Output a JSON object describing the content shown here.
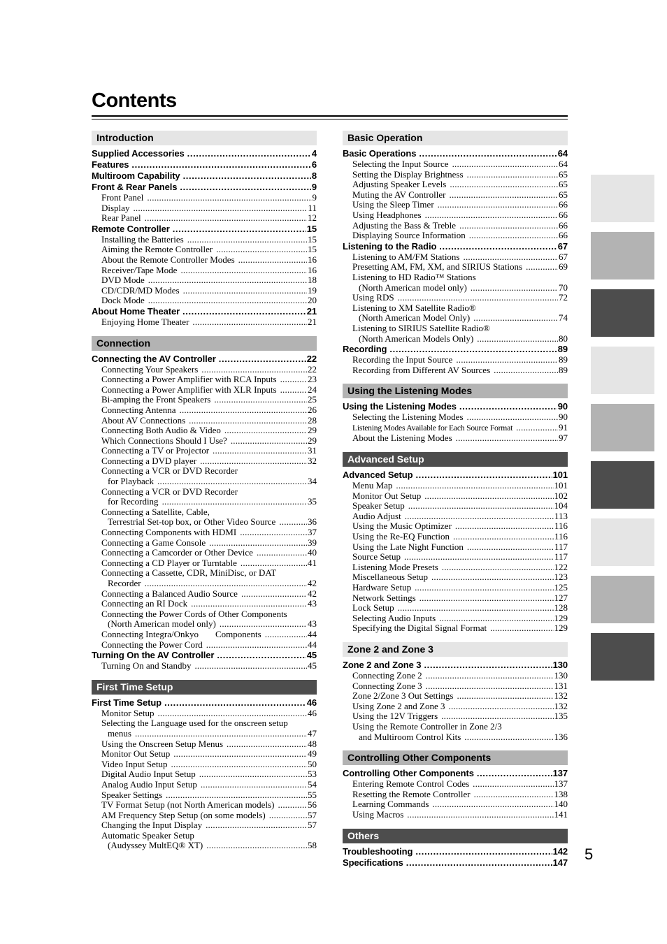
{
  "page": {
    "title": "Contents",
    "page_number": "5"
  },
  "left_column": [
    {
      "header": "Introduction",
      "style": "light",
      "entries": [
        {
          "level": 1,
          "text": "Supplied Accessories",
          "page": "4"
        },
        {
          "level": 1,
          "text": "Features",
          "page": "6"
        },
        {
          "level": 1,
          "text": "Multiroom Capability",
          "page": "8"
        },
        {
          "level": 1,
          "text": "Front & Rear Panels",
          "page": "9"
        },
        {
          "level": 2,
          "text": "Front Panel",
          "page": "9"
        },
        {
          "level": 2,
          "text": "Display",
          "page": "11"
        },
        {
          "level": 2,
          "text": "Rear Panel",
          "page": "12"
        },
        {
          "level": 1,
          "text": "Remote Controller",
          "page": "15"
        },
        {
          "level": 2,
          "text": "Installing the Batteries",
          "page": "15"
        },
        {
          "level": 2,
          "text": "Aiming the Remote Controller",
          "page": "15"
        },
        {
          "level": 2,
          "text": "About the Remote Controller Modes",
          "page": "16"
        },
        {
          "level": 2,
          "text": "Receiver/Tape Mode",
          "page": "16"
        },
        {
          "level": 2,
          "text": "DVD Mode",
          "page": "18"
        },
        {
          "level": 2,
          "text": "CD/CDR/MD Modes",
          "page": "19"
        },
        {
          "level": 2,
          "text": "Dock Mode",
          "page": "20"
        },
        {
          "level": 1,
          "text": "About Home Theater",
          "page": "21"
        },
        {
          "level": 2,
          "text": "Enjoying Home Theater",
          "page": "21"
        }
      ]
    },
    {
      "header": "Connection",
      "style": "mid",
      "entries": [
        {
          "level": 1,
          "text": "Connecting the AV Controller",
          "page": "22"
        },
        {
          "level": 2,
          "text": "Connecting Your Speakers",
          "page": "22"
        },
        {
          "level": 2,
          "text": "Connecting a Power Amplifier with RCA Inputs",
          "page": "23"
        },
        {
          "level": 2,
          "text": "Connecting a Power Amplifier with XLR Inputs",
          "page": "24"
        },
        {
          "level": 2,
          "text": "Bi-amping the Front Speakers",
          "page": "25"
        },
        {
          "level": 2,
          "text": "Connecting Antenna",
          "page": "26"
        },
        {
          "level": 2,
          "text": "About AV Connections",
          "page": "28"
        },
        {
          "level": 2,
          "text": "Connecting Both Audio & Video",
          "page": "29"
        },
        {
          "level": 2,
          "text": "Which Connections Should I Use?",
          "page": "29"
        },
        {
          "level": 2,
          "text": "Connecting a TV or Projector",
          "page": "31"
        },
        {
          "level": 2,
          "text": "Connecting a DVD player",
          "page": "32"
        },
        {
          "level": 2,
          "text": "Connecting a VCR or DVD Recorder",
          "cont": "for Playback",
          "page": "34"
        },
        {
          "level": 2,
          "text": "Connecting a VCR or DVD Recorder",
          "cont": "for Recording",
          "page": "35"
        },
        {
          "level": 2,
          "text": "Connecting a Satellite, Cable,",
          "cont": "Terrestrial Set-top box, or Other Video Source",
          "page": "36"
        },
        {
          "level": 2,
          "text": "Connecting Components with HDMI",
          "page": "37"
        },
        {
          "level": 2,
          "text": "Connecting a Game Console",
          "page": "39"
        },
        {
          "level": 2,
          "text": "Connecting a Camcorder or Other Device",
          "page": "40"
        },
        {
          "level": 2,
          "text": "Connecting a CD Player or Turntable",
          "page": "41"
        },
        {
          "level": 2,
          "text": "Connecting a Cassette, CDR, MiniDisc, or DAT",
          "cont": "Recorder",
          "page": "42"
        },
        {
          "level": 2,
          "text": "Connecting a Balanced Audio Source",
          "page": "42"
        },
        {
          "level": 2,
          "text": "Connecting an RI Dock",
          "page": "43"
        },
        {
          "level": 2,
          "text": "Connecting the Power Cords of Other Components",
          "cont": "(North American model only)",
          "page": "43"
        },
        {
          "level": 2,
          "text": "Connecting Integra/Onkyo",
          "text_after_gap": "Components",
          "page": "44"
        },
        {
          "level": 2,
          "text": "Connecting the Power Cord",
          "page": "44"
        },
        {
          "level": 1,
          "text": "Turning On the AV Controller",
          "page": "45"
        },
        {
          "level": 2,
          "text": "Turning On and Standby",
          "page": "45"
        }
      ]
    },
    {
      "header": "First Time Setup",
      "style": "dark",
      "entries": [
        {
          "level": 1,
          "text": "First Time Setup",
          "page": "46"
        },
        {
          "level": 2,
          "text": "Monitor Setup",
          "page": "46"
        },
        {
          "level": 2,
          "text": "Selecting the Language used for the onscreen setup",
          "cont": "menus",
          "page": "47"
        },
        {
          "level": 2,
          "text": "Using the Onscreen Setup Menus",
          "page": "48"
        },
        {
          "level": 2,
          "text": "Monitor Out Setup",
          "page": "49"
        },
        {
          "level": 2,
          "text": "Video Input Setup",
          "page": "50"
        },
        {
          "level": 2,
          "text": "Digital Audio Input Setup",
          "page": "53"
        },
        {
          "level": 2,
          "text": "Analog Audio Input Setup",
          "page": "54"
        },
        {
          "level": 2,
          "text": "Speaker Settings",
          "page": "55"
        },
        {
          "level": 2,
          "text": "TV Format Setup (not North American models)",
          "page": "56"
        },
        {
          "level": 2,
          "text": "AM Frequency Step Setup (on some models)",
          "page": "57"
        },
        {
          "level": 2,
          "text": "Changing the Input Display",
          "page": "57"
        },
        {
          "level": 2,
          "text": "Automatic Speaker Setup",
          "cont": "(Audyssey MultEQ® XT)",
          "page": "58"
        }
      ]
    }
  ],
  "right_column": [
    {
      "header": "Basic Operation",
      "style": "light",
      "entries": [
        {
          "level": 1,
          "text": "Basic Operations",
          "page": "64"
        },
        {
          "level": 2,
          "text": "Selecting the Input Source",
          "page": "64"
        },
        {
          "level": 2,
          "text": "Setting the Display Brightness",
          "page": "65"
        },
        {
          "level": 2,
          "text": "Adjusting Speaker Levels",
          "page": "65"
        },
        {
          "level": 2,
          "text": "Muting the AV Controller",
          "page": "65"
        },
        {
          "level": 2,
          "text": "Using the Sleep Timer",
          "page": "66"
        },
        {
          "level": 2,
          "text": "Using Headphones",
          "page": "66"
        },
        {
          "level": 2,
          "text": "Adjusting the Bass & Treble",
          "page": "66"
        },
        {
          "level": 2,
          "text": "Displaying Source Information",
          "page": "66"
        },
        {
          "level": 1,
          "text": "Listening to the Radio",
          "page": "67"
        },
        {
          "level": 2,
          "text": "Listening to AM/FM Stations",
          "page": "67"
        },
        {
          "level": 2,
          "text": "Presetting AM, FM, XM, and SIRIUS Stations",
          "page": "69"
        },
        {
          "level": 2,
          "text": "Listening to HD Radio™ Stations",
          "cont": "(North American model only)",
          "page": "70"
        },
        {
          "level": 2,
          "text": "Using RDS",
          "page": "72"
        },
        {
          "level": 2,
          "text": "Listening to XM Satellite Radio®",
          "cont": "(North American Model Only)",
          "page": "74"
        },
        {
          "level": 2,
          "text": "Listening to SIRIUS Satellite Radio®",
          "cont": "(North American Models Only)",
          "page": "80"
        },
        {
          "level": 1,
          "text": "Recording",
          "page": "89"
        },
        {
          "level": 2,
          "text": "Recording the Input Source",
          "page": "89"
        },
        {
          "level": 2,
          "text": "Recording from Different AV Sources",
          "page": "89"
        }
      ]
    },
    {
      "header": "Using the Listening Modes",
      "style": "mid",
      "entries": [
        {
          "level": 1,
          "text": "Using the Listening Modes",
          "page": "90"
        },
        {
          "level": 2,
          "text": "Selecting the Listening Modes",
          "page": "90"
        },
        {
          "level": 2,
          "text": "Listening Modes Available for Each Source Format",
          "page": "91",
          "condensed": true
        },
        {
          "level": 2,
          "text": "About the Listening Modes",
          "page": "97"
        }
      ]
    },
    {
      "header": "Advanced Setup",
      "style": "dark",
      "entries": [
        {
          "level": 1,
          "text": "Advanced Setup",
          "page": "101"
        },
        {
          "level": 2,
          "text": "Menu Map",
          "page": "101"
        },
        {
          "level": 2,
          "text": "Monitor Out Setup",
          "page": "102"
        },
        {
          "level": 2,
          "text": "Speaker Setup",
          "page": "104"
        },
        {
          "level": 2,
          "text": "Audio Adjust",
          "page": "113"
        },
        {
          "level": 2,
          "text": "Using the Music Optimizer",
          "page": "116"
        },
        {
          "level": 2,
          "text": "Using the Re-EQ Function",
          "page": "116"
        },
        {
          "level": 2,
          "text": "Using the Late Night Function",
          "page": "117"
        },
        {
          "level": 2,
          "text": "Source Setup",
          "page": "117"
        },
        {
          "level": 2,
          "text": "Listening Mode Presets",
          "page": "122"
        },
        {
          "level": 2,
          "text": "Miscellaneous Setup",
          "page": "123"
        },
        {
          "level": 2,
          "text": "Hardware Setup",
          "page": "125"
        },
        {
          "level": 2,
          "text": "Network Settings",
          "page": "127"
        },
        {
          "level": 2,
          "text": "Lock Setup",
          "page": "128"
        },
        {
          "level": 2,
          "text": "Selecting Audio Inputs",
          "page": "129"
        },
        {
          "level": 2,
          "text": "Specifying the Digital Signal Format",
          "page": "129"
        }
      ]
    },
    {
      "header": "Zone 2 and Zone 3",
      "style": "light",
      "entries": [
        {
          "level": 1,
          "text": "Zone 2 and Zone 3",
          "page": "130"
        },
        {
          "level": 2,
          "text": "Connecting Zone 2",
          "page": "130"
        },
        {
          "level": 2,
          "text": "Connecting Zone 3",
          "page": "131"
        },
        {
          "level": 2,
          "text": "Zone 2/Zone 3 Out Settings",
          "page": "132"
        },
        {
          "level": 2,
          "text": "Using Zone 2 and Zone 3",
          "page": "132"
        },
        {
          "level": 2,
          "text": "Using the 12V Triggers",
          "page": "135"
        },
        {
          "level": 2,
          "text": "Using the Remote Controller in Zone 2/3",
          "cont": "and Multiroom Control Kits",
          "page": "136"
        }
      ]
    },
    {
      "header": "Controlling Other Components",
      "style": "mid",
      "entries": [
        {
          "level": 1,
          "text": "Controlling Other Components",
          "page": "137"
        },
        {
          "level": 2,
          "text": "Entering Remote Control Codes",
          "page": "137"
        },
        {
          "level": 2,
          "text": "Resetting the Remote Controller",
          "page": "138"
        },
        {
          "level": 2,
          "text": "Learning Commands",
          "page": "140"
        },
        {
          "level": 2,
          "text": "Using Macros",
          "page": "141"
        }
      ]
    },
    {
      "header": "Others",
      "style": "dark",
      "entries": [
        {
          "level": 1,
          "text": "Troubleshooting",
          "page": "142"
        },
        {
          "level": 1,
          "text": "Specifications",
          "page": "147"
        }
      ]
    }
  ],
  "side_tabs": [
    {
      "style": "light",
      "color": "#e5e5e5"
    },
    {
      "style": "mid",
      "color": "#b3b3b3"
    },
    {
      "style": "dark",
      "color": "#4d4d4d"
    },
    {
      "style": "light",
      "color": "#e5e5e5"
    },
    {
      "style": "mid",
      "color": "#b3b3b3"
    },
    {
      "style": "dark",
      "color": "#4d4d4d"
    },
    {
      "style": "light",
      "color": "#e5e5e5"
    },
    {
      "style": "mid",
      "color": "#b3b3b3"
    },
    {
      "style": "dark",
      "color": "#4d4d4d"
    }
  ],
  "colors": {
    "header_light": "#e5e5e5",
    "header_mid": "#b3b3b3",
    "header_dark": "#4d4d4d",
    "text": "#000000"
  }
}
